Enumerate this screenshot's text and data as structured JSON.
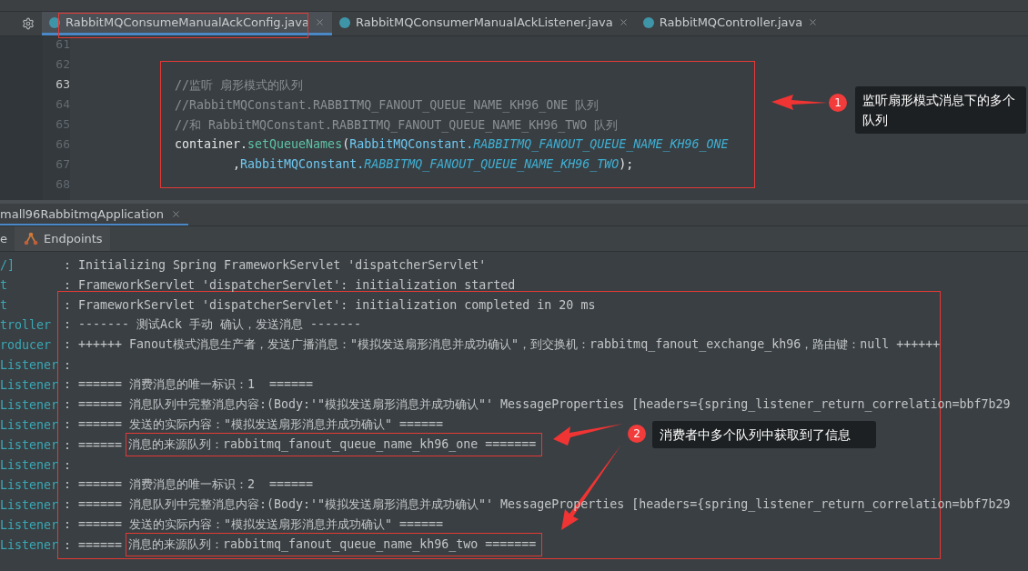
{
  "tabs": [
    {
      "label": "RabbitMQConsumeManualAckConfig.java",
      "selected": true
    },
    {
      "label": "RabbitMQConsumerManualAckListener.java",
      "selected": false
    },
    {
      "label": "RabbitMQController.java",
      "selected": false
    }
  ],
  "editor": {
    "lines": [
      {
        "number": "61",
        "current": false
      },
      {
        "number": "62",
        "current": false
      },
      {
        "number": "63",
        "current": true,
        "segments": [
          {
            "kind": "comment",
            "text": "//监听 扇形模式的队列"
          }
        ]
      },
      {
        "number": "64",
        "current": false,
        "segments": [
          {
            "kind": "comment",
            "text": "//RabbitMQConstant.RABBITMQ_FANOUT_QUEUE_NAME_KH96_ONE 队列"
          }
        ]
      },
      {
        "number": "65",
        "current": false,
        "segments": [
          {
            "kind": "comment",
            "text": "//和 RabbitMQConstant.RABBITMQ_FANOUT_QUEUE_NAME_KH96_TWO 队列"
          }
        ]
      },
      {
        "number": "66",
        "current": false,
        "segments": [
          {
            "kind": "plain",
            "text": "container."
          },
          {
            "kind": "method",
            "text": "setQueueNames"
          },
          {
            "kind": "plain",
            "text": "("
          },
          {
            "kind": "class",
            "text": "RabbitMQConstant."
          },
          {
            "kind": "constant",
            "text": "RABBITMQ_FANOUT_QUEUE_NAME_KH96_ONE"
          }
        ]
      },
      {
        "number": "67",
        "current": false,
        "segments": [
          {
            "kind": "plain",
            "text": "        ,"
          },
          {
            "kind": "class",
            "text": "RabbitMQConstant."
          },
          {
            "kind": "constant",
            "text": "RABBITMQ_FANOUT_QUEUE_NAME_KH96_TWO"
          },
          {
            "kind": "plain",
            "text": ");"
          }
        ]
      },
      {
        "number": "68",
        "current": false
      }
    ]
  },
  "run_tab": {
    "label": "mall96RabbitmqApplication"
  },
  "console_toolbar": [
    {
      "label": "e",
      "kind": "plain"
    },
    {
      "label": "Endpoints",
      "kind": "endpoints"
    }
  ],
  "console": {
    "lines": [
      {
        "source": "/]",
        "message": ": Initializing Spring FrameworkServlet 'dispatcherServlet'"
      },
      {
        "source": "t",
        "message": ": FrameworkServlet 'dispatcherServlet': initialization started"
      },
      {
        "source": "t",
        "message": ": FrameworkServlet 'dispatcherServlet': initialization completed in 20 ms"
      },
      {
        "source": "troller",
        "message": ": ------- 测试Ack 手动 确认，发送消息 -------"
      },
      {
        "source": "roducer",
        "message": ": ++++++ Fanout模式消息生产者，发送广播消息：\"模拟发送扇形消息并成功确认\"，到交换机：rabbitmq_fanout_exchange_kh96，路由键：null ++++++"
      },
      {
        "source": "Listener",
        "message": ":"
      },
      {
        "source": "Listener",
        "message": ": ====== 消费消息的唯一标识：1  ======"
      },
      {
        "source": "Listener",
        "message": ": ====== 消息队列中完整消息内容:(Body:'\"模拟发送扇形消息并成功确认\"' MessageProperties [headers={spring_listener_return_correlation=bbf7b29"
      },
      {
        "source": "Listener",
        "message": ": ====== 发送的实际内容：\"模拟发送扇形消息并成功确认\" ======"
      },
      {
        "source": "Listener",
        "lead": ": ======",
        "message": "消息的来源队列：rabbitmq_fanout_queue_name_kh96_one =======",
        "highlighted": true
      },
      {
        "source": "Listener",
        "message": ":"
      },
      {
        "source": "Listener",
        "message": ": ====== 消费消息的唯一标识：2  ======"
      },
      {
        "source": "Listener",
        "message": ": ====== 消息队列中完整消息内容:(Body:'\"模拟发送扇形消息并成功确认\"' MessageProperties [headers={spring_listener_return_correlation=bbf7b29"
      },
      {
        "source": "Listener",
        "message": ": ====== 发送的实际内容：\"模拟发送扇形消息并成功确认\" ======"
      },
      {
        "source": "Listener",
        "lead": ": ======",
        "message": "消息的来源队列：rabbitmq_fanout_queue_name_kh96_two =======",
        "highlighted": true
      }
    ]
  },
  "annotations": [
    {
      "number": "1",
      "text": "监听扇形模式消息下的多个队列"
    },
    {
      "number": "2",
      "text": "消费者中多个队列中获取到了信息"
    }
  ]
}
